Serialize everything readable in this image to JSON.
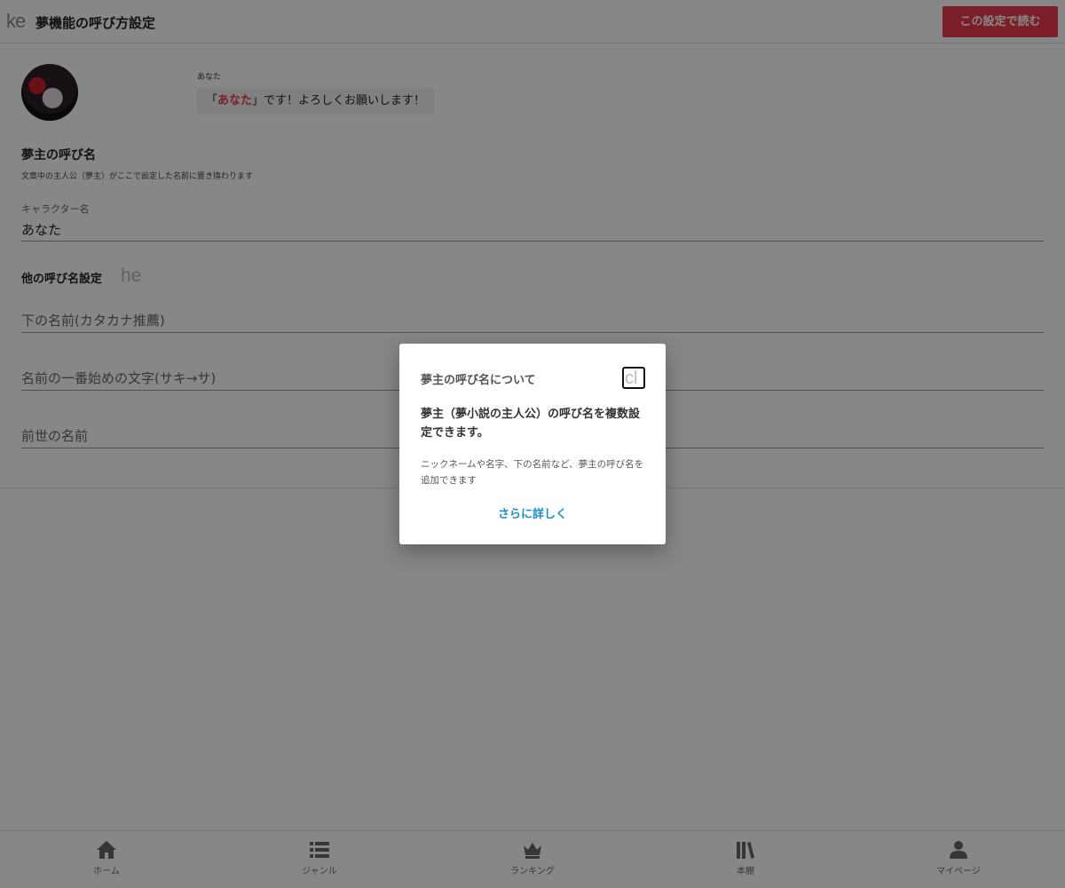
{
  "header": {
    "back_glyph": "ke",
    "title": "夢機能の呼び方設定",
    "read_button": "この設定で読む"
  },
  "preview": {
    "speaker": "あなた",
    "bubble_prefix": "「",
    "bubble_name": "あなた",
    "bubble_suffix": "」です！よろしくお願いします！"
  },
  "dream_name": {
    "title": "夢主の呼び名",
    "description": "文章中の主人公（夢主）がここで設定した名前に置き換わります",
    "character_label": "キャラクター名",
    "character_value": "あなた"
  },
  "other_names": {
    "title": "他の呼び名設定",
    "help_glyph": "he",
    "fields": [
      {
        "placeholder": "下の名前(カタカナ推薦)"
      },
      {
        "placeholder": "名前の一番始めの文字(サキ→サ)"
      },
      {
        "placeholder": "前世の名前"
      }
    ]
  },
  "nav": {
    "items": [
      {
        "label": "ホーム",
        "icon": "home-icon"
      },
      {
        "label": "ジャンル",
        "icon": "list-icon"
      },
      {
        "label": "ランキング",
        "icon": "crown-icon"
      },
      {
        "label": "本棚",
        "icon": "bookshelf-icon"
      },
      {
        "label": "マイページ",
        "icon": "user-icon"
      }
    ]
  },
  "modal": {
    "title": "夢主の呼び名について",
    "close_glyph": "cl",
    "lead": "夢主（夢小説の主人公）の呼び名を複数設定できます。",
    "body": "ニックネームや名字、下の名前など、夢主の呼び名を追加できます",
    "more_link": "さらに詳しく"
  },
  "colors": {
    "accent": "#e8394a",
    "link": "#1a8fc9"
  }
}
